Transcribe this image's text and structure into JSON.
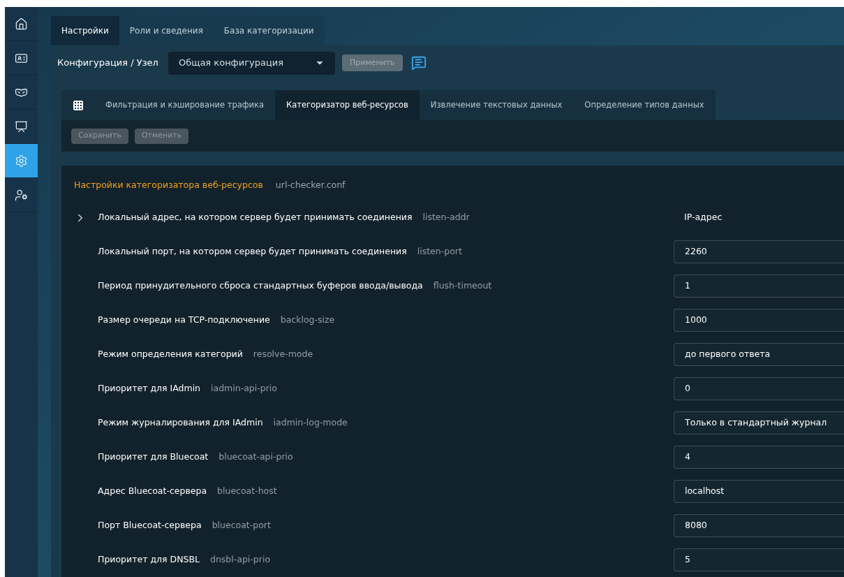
{
  "sidebar": {
    "items": [
      {
        "selected": false
      },
      {
        "selected": false
      },
      {
        "selected": false
      },
      {
        "selected": false
      },
      {
        "selected": true
      },
      {
        "selected": false
      }
    ]
  },
  "top_tabs": [
    {
      "label": "Настройки",
      "selected": true
    },
    {
      "label": "Роли и сведения",
      "selected": false
    },
    {
      "label": "База категоризации",
      "selected": false
    }
  ],
  "config": {
    "label": "Конфигурация / Узел",
    "select_value": "Общая конфигурация",
    "apply_button": "Применить"
  },
  "sub_tabs": [
    {
      "label": "Фильтрация и кэширование трафика",
      "selected": false
    },
    {
      "label": "Категоризатор веб-ресурсов",
      "selected": true
    },
    {
      "label": "Извлечение текстовых данных",
      "selected": false
    },
    {
      "label": "Определение типов данных",
      "selected": false
    }
  ],
  "toolbar": {
    "buttons": [
      "Сохранить",
      "Отменить"
    ]
  },
  "section": {
    "title": "Настройки категоризатора веб-ресурсов",
    "file": "url-checker.conf"
  },
  "rows": [
    {
      "kind": "group",
      "label": "Локальный адрес, на котором сервер будет принимать соединения",
      "key": "listen-addr",
      "value": "IP-адрес",
      "expanded": false
    },
    {
      "kind": "input",
      "label": "Локальный порт, на котором сервер будет принимать соединения",
      "key": "listen-port",
      "value": "2260"
    },
    {
      "kind": "input",
      "label": "Период принудительного сброса стандартных буферов ввода/вывода",
      "key": "flush-timeout",
      "value": "1"
    },
    {
      "kind": "input",
      "label": "Размер очереди на TCP-подключение",
      "key": "backlog-size",
      "value": "1000"
    },
    {
      "kind": "input",
      "label": "Режим определения категорий",
      "key": "resolve-mode",
      "value": "до первого ответа"
    },
    {
      "kind": "input",
      "label": "Приоритет для IAdmin",
      "key": "iadmin-api-prio",
      "value": "0"
    },
    {
      "kind": "input",
      "label": "Режим журналирования для IAdmin",
      "key": "iadmin-log-mode",
      "value": "Только в стандартный журнал"
    },
    {
      "kind": "input",
      "label": "Приоритет для Bluecoat",
      "key": "bluecoat-api-prio",
      "value": "4"
    },
    {
      "kind": "input",
      "label": "Адрес Bluecoat-сервера",
      "key": "bluecoat-host",
      "value": "localhost"
    },
    {
      "kind": "input",
      "label": "Порт Bluecoat-сервера",
      "key": "bluecoat-port",
      "value": "8080"
    },
    {
      "kind": "input",
      "label": "Приоритет для DNSBL",
      "key": "dnsbl-api-prio",
      "value": "5"
    }
  ]
}
